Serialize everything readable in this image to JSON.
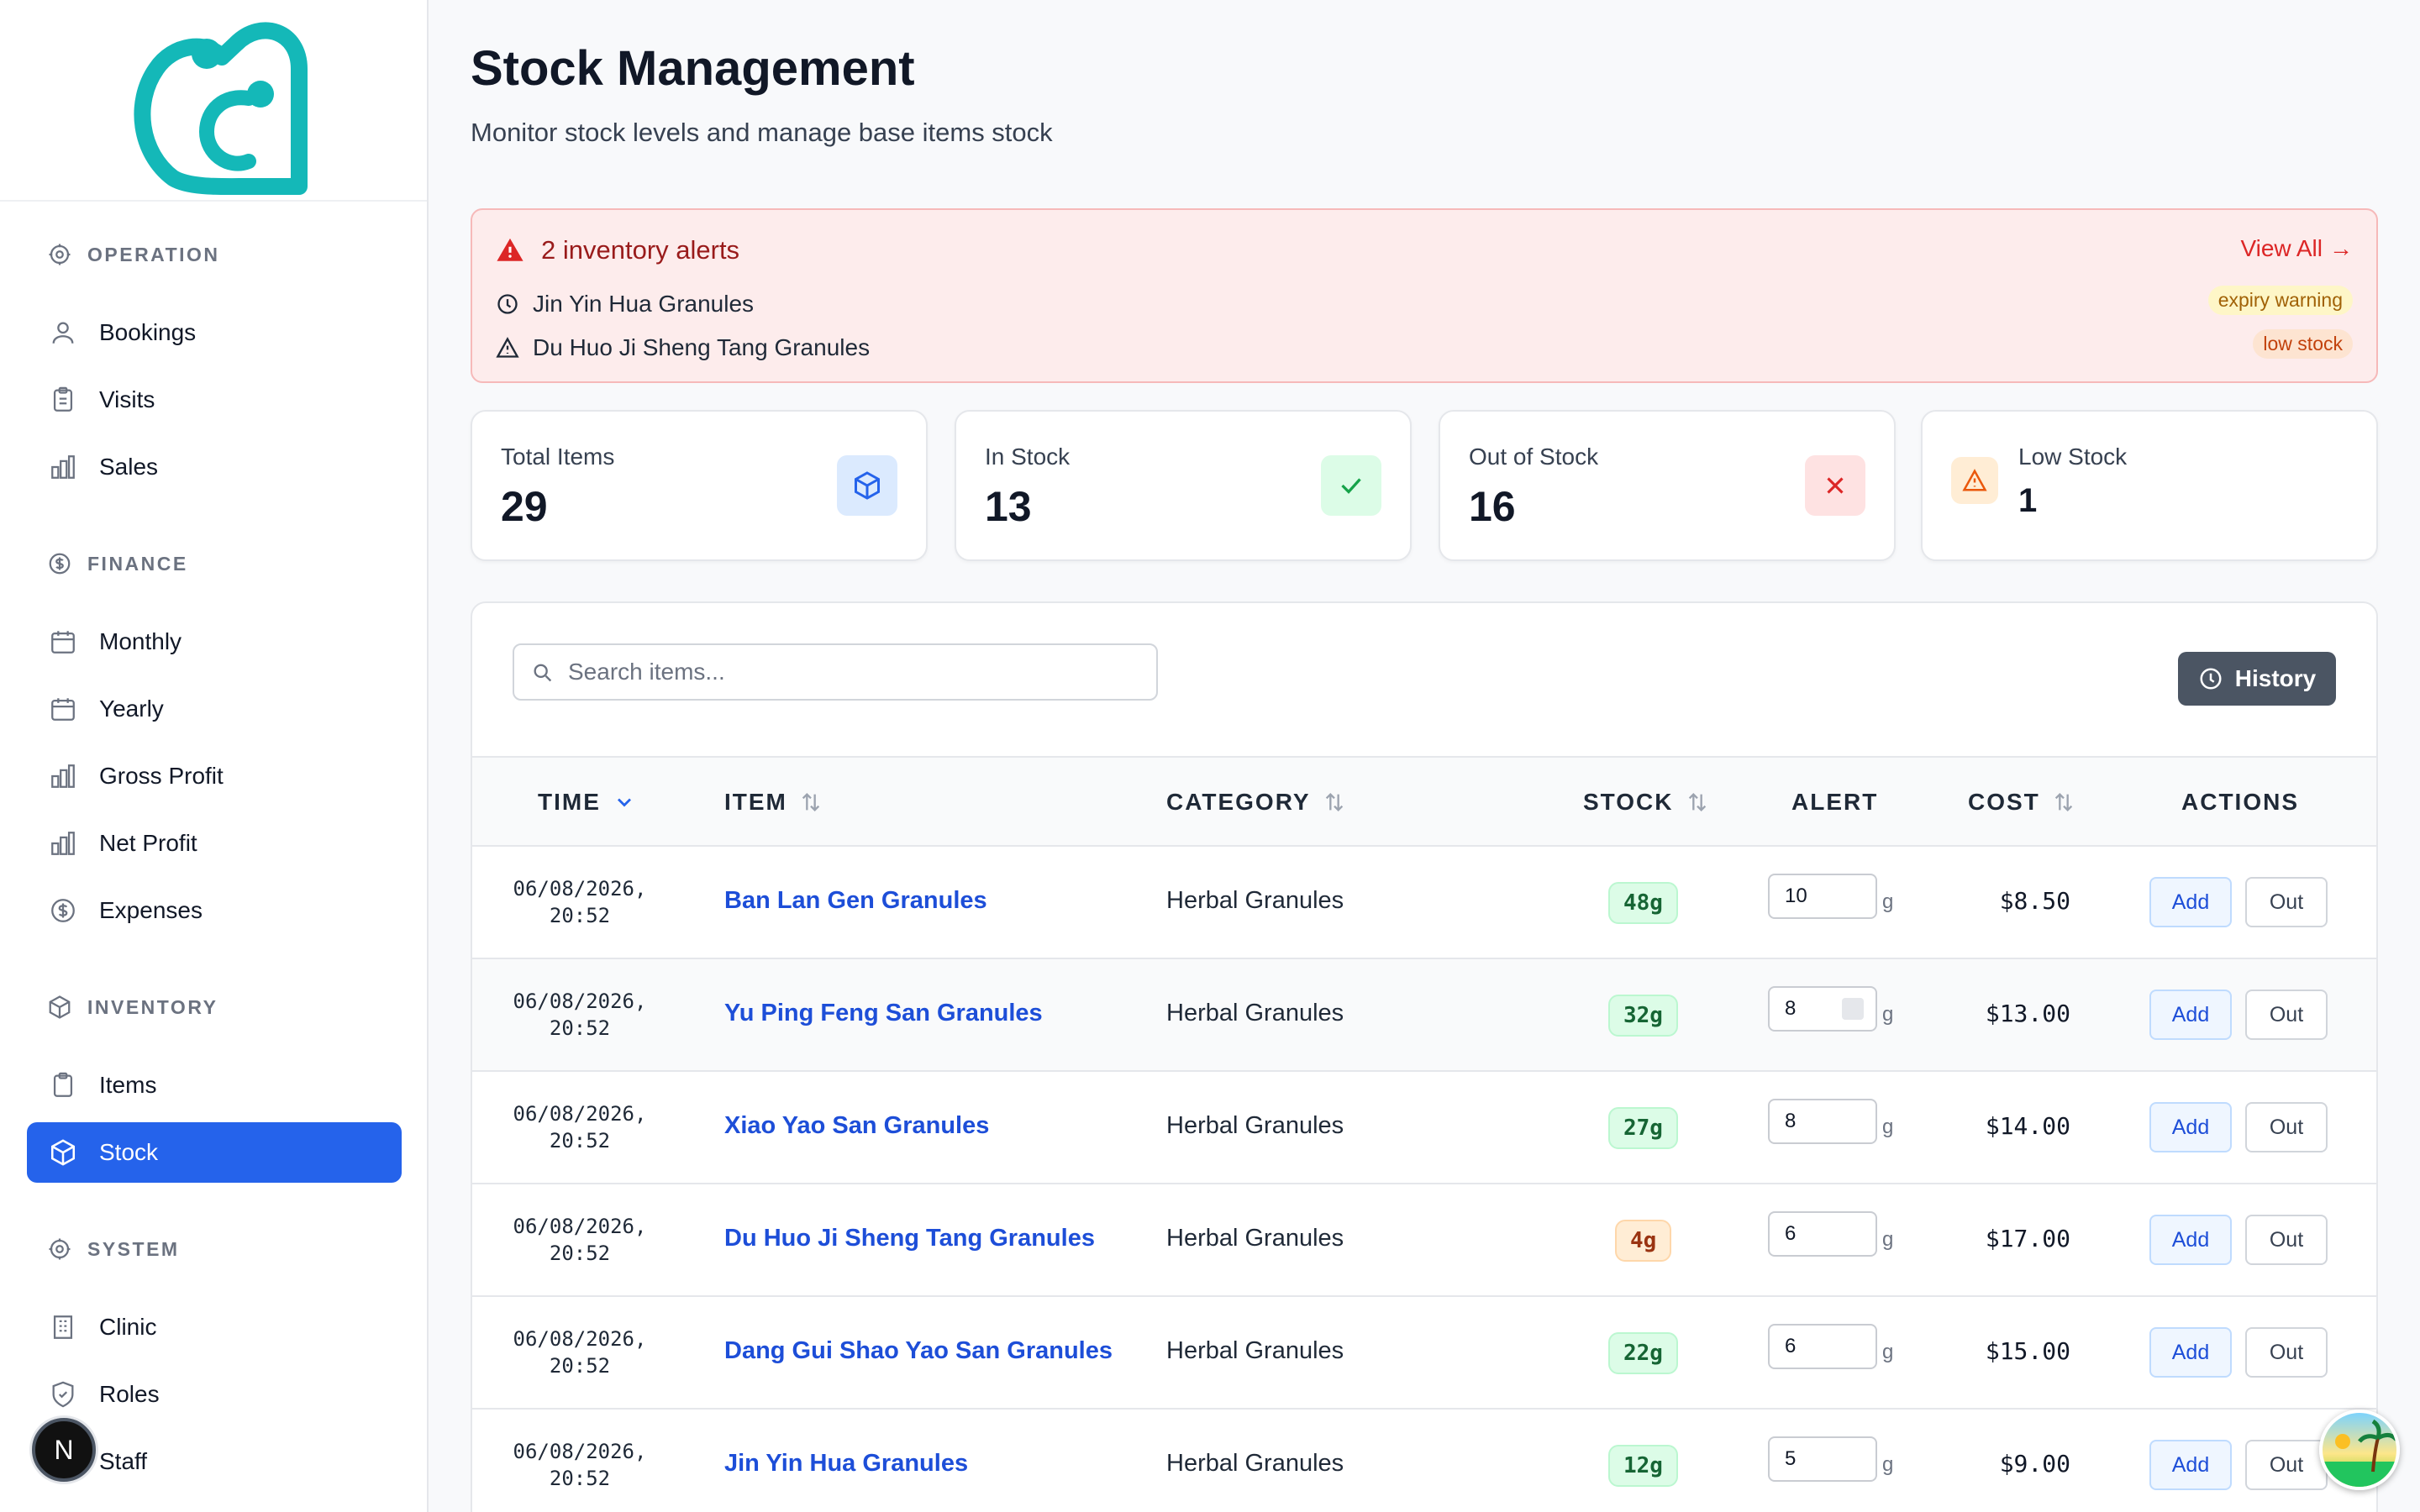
{
  "sidebar": {
    "sections": [
      {
        "title": "OPERATION",
        "icon": "gear-icon",
        "items": [
          {
            "label": "Bookings",
            "icon": "user-icon"
          },
          {
            "label": "Visits",
            "icon": "clipboard-icon"
          },
          {
            "label": "Sales",
            "icon": "bar-chart-icon"
          }
        ]
      },
      {
        "title": "FINANCE",
        "icon": "dollar-circle-icon",
        "items": [
          {
            "label": "Monthly",
            "icon": "calendar-icon"
          },
          {
            "label": "Yearly",
            "icon": "calendar-icon"
          },
          {
            "label": "Gross Profit",
            "icon": "bar-chart-icon"
          },
          {
            "label": "Net Profit",
            "icon": "bar-chart-icon"
          },
          {
            "label": "Expenses",
            "icon": "dollar-circle-icon"
          }
        ]
      },
      {
        "title": "INVENTORY",
        "icon": "box-icon",
        "items": [
          {
            "label": "Items",
            "icon": "clipboard-icon"
          },
          {
            "label": "Stock",
            "icon": "box-icon",
            "active": true
          }
        ]
      },
      {
        "title": "SYSTEM",
        "icon": "gear-icon",
        "items": [
          {
            "label": "Clinic",
            "icon": "building-icon"
          },
          {
            "label": "Roles",
            "icon": "shield-icon"
          },
          {
            "label": "Staff",
            "icon": "users-icon"
          }
        ]
      }
    ],
    "avatar_initial": "N",
    "active_color": "#2563eb"
  },
  "header": {
    "title": "Stock Management",
    "subtitle": "Monitor stock levels and manage base items stock"
  },
  "alerts": {
    "title": "2 inventory alerts",
    "view_all": "View All",
    "items": [
      {
        "name": "Jin Yin Hua Granules",
        "badge": "expiry warning",
        "icon": "clock-icon"
      },
      {
        "name": "Du Huo Ji Sheng Tang Granules",
        "badge": "low stock",
        "icon": "warning-icon"
      }
    ]
  },
  "stats": [
    {
      "label": "Total Items",
      "value": "29",
      "icon": "box-icon",
      "color": "#2563eb"
    },
    {
      "label": "In Stock",
      "value": "13",
      "icon": "check-icon",
      "color": "#16a34a"
    },
    {
      "label": "Out of Stock",
      "value": "16",
      "icon": "x-icon",
      "color": "#dc2626"
    },
    {
      "label": "Low Stock",
      "value": "1",
      "icon": "warning-icon",
      "color": "#ea580c"
    }
  ],
  "toolbar": {
    "search_placeholder": "Search items...",
    "history_label": "History"
  },
  "table": {
    "columns": [
      "TIME",
      "ITEM",
      "CATEGORY",
      "STOCK",
      "ALERT",
      "COST",
      "ACTIONS"
    ],
    "add_label": "Add",
    "out_label": "Out",
    "unit": "g",
    "rows": [
      {
        "date": "06/08/2026,",
        "time": "20:52",
        "item": "Ban Lan Gen Granules",
        "category": "Herbal Granules",
        "stock": "48g",
        "stock_status": "ok",
        "alert": "10",
        "cost": "$8.50"
      },
      {
        "date": "06/08/2026,",
        "time": "20:52",
        "item": "Yu Ping Feng San Granules",
        "category": "Herbal Granules",
        "stock": "32g",
        "stock_status": "ok",
        "alert": "8",
        "cost": "$13.00",
        "focused": true
      },
      {
        "date": "06/08/2026,",
        "time": "20:52",
        "item": "Xiao Yao San Granules",
        "category": "Herbal Granules",
        "stock": "27g",
        "stock_status": "ok",
        "alert": "8",
        "cost": "$14.00"
      },
      {
        "date": "06/08/2026,",
        "time": "20:52",
        "item": "Du Huo Ji Sheng Tang Granules",
        "category": "Herbal Granules",
        "stock": "4g",
        "stock_status": "low",
        "alert": "6",
        "cost": "$17.00"
      },
      {
        "date": "06/08/2026,",
        "time": "20:52",
        "item": "Dang Gui Shao Yao San Granules",
        "category": "Herbal Granules",
        "stock": "22g",
        "stock_status": "ok",
        "alert": "6",
        "cost": "$15.00"
      },
      {
        "date": "06/08/2026,",
        "time": "20:52",
        "item": "Jin Yin Hua Granules",
        "category": "Herbal Granules",
        "stock": "12g",
        "stock_status": "ok",
        "alert": "5",
        "cost": "$9.00"
      }
    ]
  }
}
